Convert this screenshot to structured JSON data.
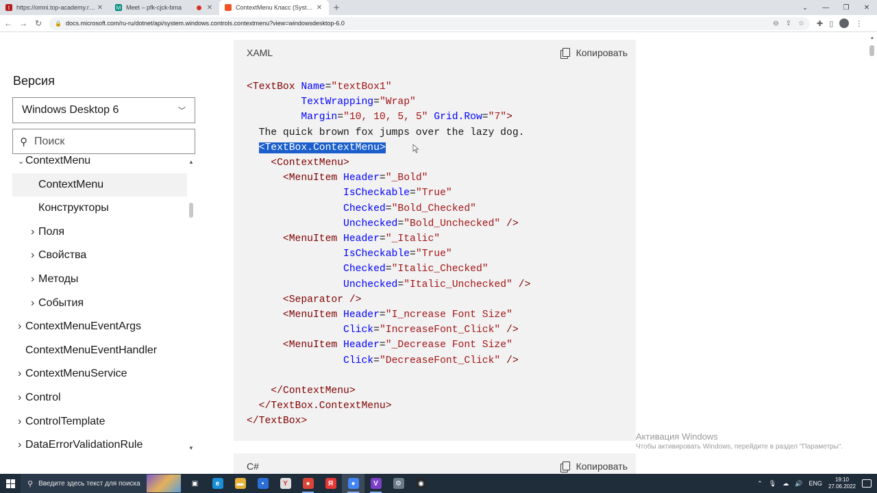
{
  "browser": {
    "tabs": [
      {
        "title": "https://omni.top-academy.ru/#/",
        "favicon_color": "#b71c1c",
        "favicon_glyph": "t",
        "active": false,
        "recording": false
      },
      {
        "title": "Meet – pfk-cjck-bma",
        "favicon_color": "#00897b",
        "favicon_glyph": "M",
        "active": false,
        "recording": true
      },
      {
        "title": "ContextMenu Класс (System.Wi",
        "favicon_color": "#f35325",
        "favicon_glyph": "",
        "active": true,
        "recording": false
      }
    ],
    "url": "docs.microsoft.com/ru-ru/dotnet/api/system.windows.controls.contextmenu?view=windowsdesktop-6.0"
  },
  "sidebar": {
    "version_title": "Версия",
    "version_selected": "Windows Desktop 6",
    "search_placeholder": "Поиск",
    "toc": [
      {
        "label": "ContextMenu",
        "level": 0,
        "expander": "v",
        "partial": true
      },
      {
        "label": "ContextMenu",
        "level": 1,
        "expander": "",
        "selected": true
      },
      {
        "label": "Конструкторы",
        "level": 1,
        "expander": ""
      },
      {
        "label": "Поля",
        "level": 1,
        "expander": ">"
      },
      {
        "label": "Свойства",
        "level": 1,
        "expander": ">"
      },
      {
        "label": "Методы",
        "level": 1,
        "expander": ">"
      },
      {
        "label": "События",
        "level": 1,
        "expander": ">"
      },
      {
        "label": "ContextMenuEventArgs",
        "level": 0,
        "expander": ">"
      },
      {
        "label": "ContextMenuEventHandler",
        "level": 0,
        "expander": ""
      },
      {
        "label": "ContextMenuService",
        "level": 0,
        "expander": ">"
      },
      {
        "label": "Control",
        "level": 0,
        "expander": ">"
      },
      {
        "label": "ControlTemplate",
        "level": 0,
        "expander": ">"
      },
      {
        "label": "DataErrorValidationRule",
        "level": 0,
        "expander": ">"
      }
    ]
  },
  "code_block": {
    "language": "XAML",
    "copy_label": "Копировать",
    "lines": [
      [
        {
          "t": "t",
          "s": "<TextBox "
        },
        {
          "t": "a",
          "s": "Name"
        },
        {
          "t": "",
          "s": "="
        },
        {
          "t": "v",
          "s": "\"textBox1\""
        }
      ],
      [
        {
          "t": "",
          "s": "         "
        },
        {
          "t": "a",
          "s": "TextWrapping"
        },
        {
          "t": "",
          "s": "="
        },
        {
          "t": "v",
          "s": "\"Wrap\""
        }
      ],
      [
        {
          "t": "",
          "s": "         "
        },
        {
          "t": "a",
          "s": "Margin"
        },
        {
          "t": "",
          "s": "="
        },
        {
          "t": "v",
          "s": "\"10, 10, 5, 5\""
        },
        {
          "t": "",
          "s": " "
        },
        {
          "t": "a",
          "s": "Grid.Row"
        },
        {
          "t": "",
          "s": "="
        },
        {
          "t": "v",
          "s": "\"7\""
        },
        {
          "t": "t",
          "s": ">"
        }
      ],
      [
        {
          "t": "",
          "s": "  The quick brown fox jumps over the lazy dog."
        }
      ],
      [
        {
          "t": "",
          "s": "  "
        },
        {
          "t": "hl",
          "s": "<TextBox.ContextMenu>"
        }
      ],
      [
        {
          "t": "",
          "s": "    "
        },
        {
          "t": "t",
          "s": "<ContextMenu>"
        }
      ],
      [
        {
          "t": "",
          "s": "      "
        },
        {
          "t": "t",
          "s": "<MenuItem "
        },
        {
          "t": "a",
          "s": "Header"
        },
        {
          "t": "",
          "s": "="
        },
        {
          "t": "v",
          "s": "\"_Bold\""
        }
      ],
      [
        {
          "t": "",
          "s": "                "
        },
        {
          "t": "a",
          "s": "IsCheckable"
        },
        {
          "t": "",
          "s": "="
        },
        {
          "t": "v",
          "s": "\"True\""
        }
      ],
      [
        {
          "t": "",
          "s": "                "
        },
        {
          "t": "a",
          "s": "Checked"
        },
        {
          "t": "",
          "s": "="
        },
        {
          "t": "v",
          "s": "\"Bold_Checked\""
        }
      ],
      [
        {
          "t": "",
          "s": "                "
        },
        {
          "t": "a",
          "s": "Unchecked"
        },
        {
          "t": "",
          "s": "="
        },
        {
          "t": "v",
          "s": "\"Bold_Unchecked\""
        },
        {
          "t": "",
          "s": " "
        },
        {
          "t": "t",
          "s": "/>"
        }
      ],
      [
        {
          "t": "",
          "s": "      "
        },
        {
          "t": "t",
          "s": "<MenuItem "
        },
        {
          "t": "a",
          "s": "Header"
        },
        {
          "t": "",
          "s": "="
        },
        {
          "t": "v",
          "s": "\"_Italic\""
        }
      ],
      [
        {
          "t": "",
          "s": "                "
        },
        {
          "t": "a",
          "s": "IsCheckable"
        },
        {
          "t": "",
          "s": "="
        },
        {
          "t": "v",
          "s": "\"True\""
        }
      ],
      [
        {
          "t": "",
          "s": "                "
        },
        {
          "t": "a",
          "s": "Checked"
        },
        {
          "t": "",
          "s": "="
        },
        {
          "t": "v",
          "s": "\"Italic_Checked\""
        }
      ],
      [
        {
          "t": "",
          "s": "                "
        },
        {
          "t": "a",
          "s": "Unchecked"
        },
        {
          "t": "",
          "s": "="
        },
        {
          "t": "v",
          "s": "\"Italic_Unchecked\""
        },
        {
          "t": "",
          "s": " "
        },
        {
          "t": "t",
          "s": "/>"
        }
      ],
      [
        {
          "t": "",
          "s": "      "
        },
        {
          "t": "t",
          "s": "<Separator />"
        }
      ],
      [
        {
          "t": "",
          "s": "      "
        },
        {
          "t": "t",
          "s": "<MenuItem "
        },
        {
          "t": "a",
          "s": "Header"
        },
        {
          "t": "",
          "s": "="
        },
        {
          "t": "v",
          "s": "\"I_ncrease Font Size\""
        }
      ],
      [
        {
          "t": "",
          "s": "                "
        },
        {
          "t": "a",
          "s": "Click"
        },
        {
          "t": "",
          "s": "="
        },
        {
          "t": "v",
          "s": "\"IncreaseFont_Click\""
        },
        {
          "t": "",
          "s": " "
        },
        {
          "t": "t",
          "s": "/>"
        }
      ],
      [
        {
          "t": "",
          "s": "      "
        },
        {
          "t": "t",
          "s": "<MenuItem "
        },
        {
          "t": "a",
          "s": "Header"
        },
        {
          "t": "",
          "s": "="
        },
        {
          "t": "v",
          "s": "\"_Decrease Font Size\""
        }
      ],
      [
        {
          "t": "",
          "s": "                "
        },
        {
          "t": "a",
          "s": "Click"
        },
        {
          "t": "",
          "s": "="
        },
        {
          "t": "v",
          "s": "\"DecreaseFont_Click\""
        },
        {
          "t": "",
          "s": " "
        },
        {
          "t": "t",
          "s": "/>"
        }
      ],
      [
        {
          "t": "",
          "s": ""
        }
      ],
      [
        {
          "t": "",
          "s": "    "
        },
        {
          "t": "t",
          "s": "</ContextMenu>"
        }
      ],
      [
        {
          "t": "",
          "s": "  "
        },
        {
          "t": "t",
          "s": "</TextBox.ContextMenu>"
        }
      ],
      [
        {
          "t": "t",
          "s": "</TextBox>"
        }
      ]
    ]
  },
  "code_block2": {
    "language": "C#",
    "copy_label": "Копировать"
  },
  "watermark": {
    "line1": "Активация Windows",
    "line2": "Чтобы активировать Windows, перейдите в раздел \"Параметры\"."
  },
  "taskbar": {
    "search_placeholder": "Введите здесь текст для поиска",
    "apps": [
      {
        "name": "task-view",
        "color": "#1f2c3a",
        "glyph": "▣"
      },
      {
        "name": "edge",
        "color": "#1a8fd8",
        "glyph": "e"
      },
      {
        "name": "explorer",
        "color": "#e8b23a",
        "glyph": "▬"
      },
      {
        "name": "store",
        "color": "#2b6fd6",
        "glyph": "▪"
      },
      {
        "name": "yandex",
        "color": "#e0e0e0",
        "glyph": "Y"
      },
      {
        "name": "chrome",
        "color": "#db4437",
        "glyph": "●"
      },
      {
        "name": "yandex-browser",
        "color": "#e53935",
        "glyph": "Я"
      },
      {
        "name": "chrome-active",
        "color": "#4285f4",
        "glyph": "●"
      },
      {
        "name": "visual-studio",
        "color": "#7b3fc9",
        "glyph": "V"
      },
      {
        "name": "settings-tool",
        "color": "#6c7a89",
        "glyph": "⚙"
      },
      {
        "name": "github",
        "color": "#24292e",
        "glyph": "◉"
      }
    ],
    "lang": "ENG",
    "time": "19:10",
    "date": "27.06.2022"
  }
}
